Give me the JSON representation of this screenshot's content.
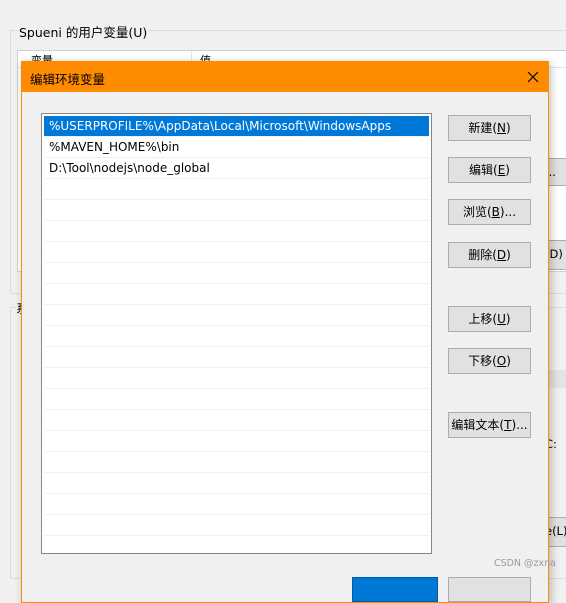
{
  "background_window": {
    "user_vars_group_label": "Spueni 的用户变量(U)",
    "list_header_col1": "变量",
    "list_header_col2": "值",
    "right_button_partial_1": "...",
    "right_button_partial_2": "(D)",
    "right_button_partial_3": "C:",
    "right_button_partial_4": "e(L)",
    "system_vars_group_partial": "系"
  },
  "dialog": {
    "title": "编辑环境变量",
    "path_entries": [
      "%USERPROFILE%\\AppData\\Local\\Microsoft\\WindowsApps",
      "%MAVEN_HOME%\\bin",
      "D:\\Tool\\nodejs\\node_global"
    ],
    "selected_index": 0,
    "buttons": {
      "new": {
        "label": "新建(",
        "key": "N",
        "tail": ")"
      },
      "edit": {
        "label": "编辑(",
        "key": "E",
        "tail": ")"
      },
      "browse": {
        "label": "浏览(",
        "key": "B",
        "tail": ")..."
      },
      "delete": {
        "label": "删除(",
        "key": "D",
        "tail": ")"
      },
      "move_up": {
        "label": "上移(",
        "key": "U",
        "tail": ")"
      },
      "move_down": {
        "label": "下移(",
        "key": "O",
        "tail": ")"
      },
      "edit_text": {
        "label": "编辑文本(",
        "key": "T",
        "tail": ")..."
      }
    }
  },
  "watermark": "CSDN @zxna",
  "colors": {
    "titlebar": "#ff8c00",
    "selection": "#0078d7"
  }
}
